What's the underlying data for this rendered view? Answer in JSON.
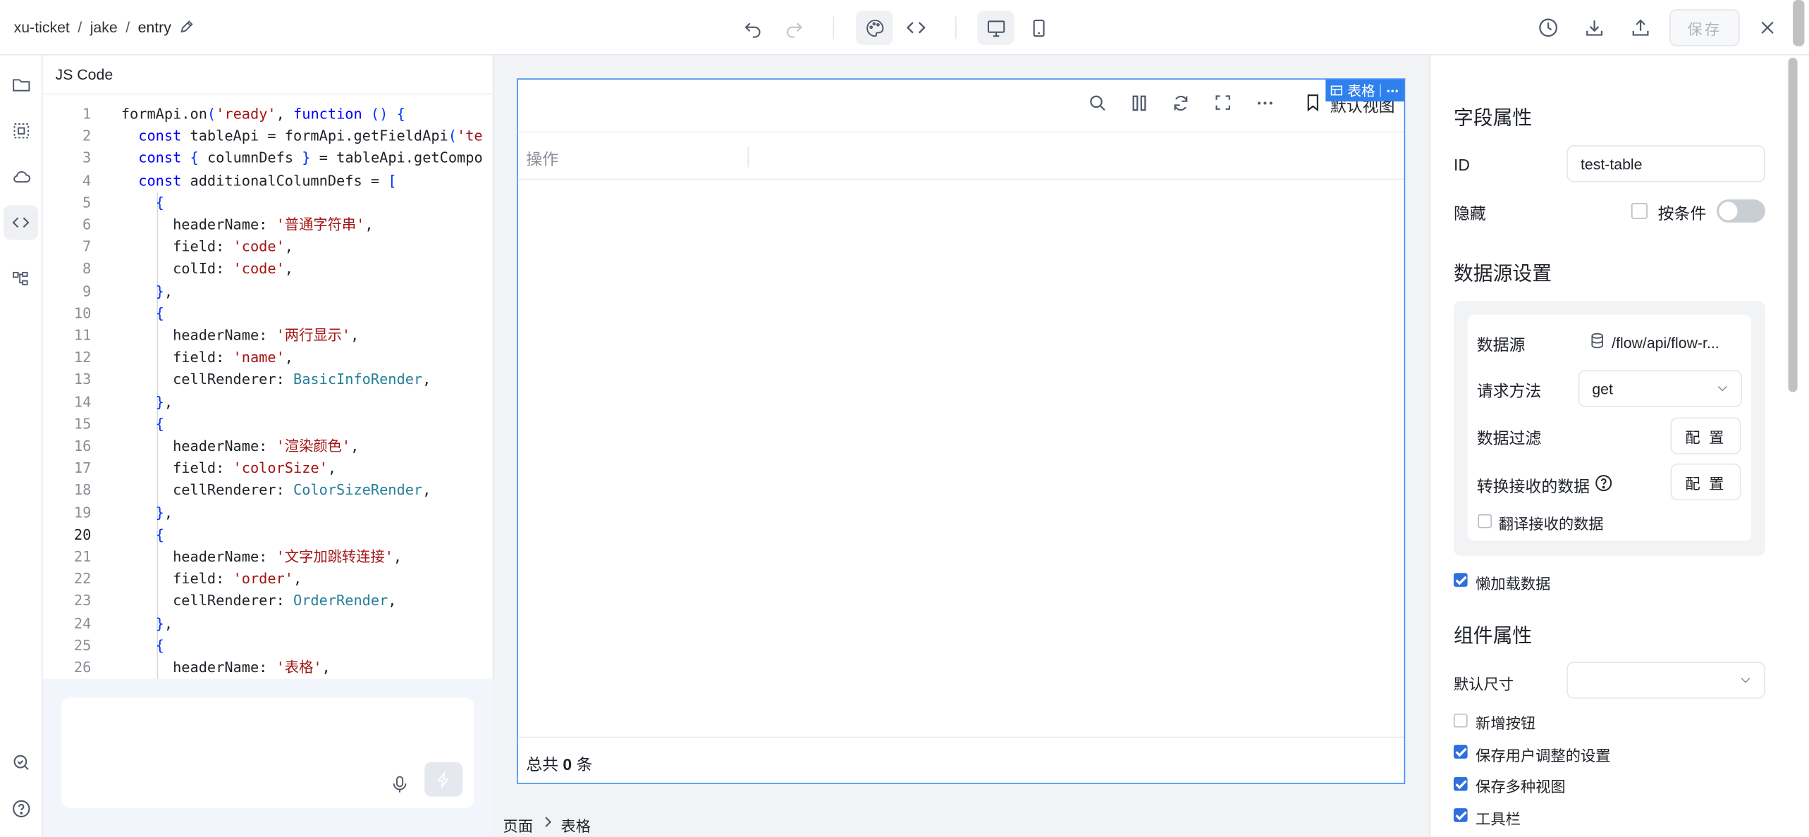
{
  "breadcrumb": {
    "project": "xu-ticket",
    "user": "jake",
    "page": "entry",
    "sep": "/"
  },
  "toolbar": {
    "save_label": "保存"
  },
  "code_panel": {
    "title": "JS Code",
    "current_line": 20,
    "lines": [
      {
        "n": "1"
      },
      {
        "n": "2"
      },
      {
        "n": "3"
      },
      {
        "n": "4"
      },
      {
        "n": "5"
      },
      {
        "n": "6"
      },
      {
        "n": "7"
      },
      {
        "n": "8"
      },
      {
        "n": "9"
      },
      {
        "n": "10"
      },
      {
        "n": "11"
      },
      {
        "n": "12"
      },
      {
        "n": "13"
      },
      {
        "n": "14"
      },
      {
        "n": "15"
      },
      {
        "n": "16"
      },
      {
        "n": "17"
      },
      {
        "n": "18"
      },
      {
        "n": "19"
      },
      {
        "n": "20"
      },
      {
        "n": "21"
      },
      {
        "n": "22"
      },
      {
        "n": "23"
      },
      {
        "n": "24"
      },
      {
        "n": "25"
      },
      {
        "n": "26"
      }
    ],
    "code": [
      "formApi.on('ready', function () {",
      "  const tableApi = formApi.getFieldApi('te",
      "  const { columnDefs } = tableApi.getCompo",
      "  const additionalColumnDefs = [",
      "    {",
      "      headerName: '普通字符串',",
      "      field: 'code',",
      "      colId: 'code',",
      "    },",
      "    {",
      "      headerName: '两行显示',",
      "      field: 'name',",
      "      cellRenderer: BasicInfoRender,",
      "    },",
      "    {",
      "      headerName: '渲染颜色',",
      "      field: 'colorSize',",
      "      cellRenderer: ColorSizeRender,",
      "    },",
      "    {",
      "      headerName: '文字加跳转连接',",
      "      field: 'order',",
      "      cellRenderer: OrderRender,",
      "    },",
      "    {",
      "      headerName: '表格',"
    ]
  },
  "canvas": {
    "tag_label": "表格",
    "view_label": "默认视图",
    "column_header": "操作",
    "footer_prefix": "总共",
    "footer_count": "0",
    "footer_suffix": "条",
    "crumb_page": "页面",
    "crumb_item": "表格"
  },
  "props": {
    "field_section": "字段属性",
    "id_label": "ID",
    "id_value": "test-table",
    "hidden_label": "隐藏",
    "by_condition_label": "按条件",
    "datasource_section": "数据源设置",
    "datasource_label": "数据源",
    "datasource_value": "/flow/api/flow-r...",
    "method_label": "请求方法",
    "method_value": "get",
    "filter_label": "数据过滤",
    "config_label": "配 置",
    "transform_label": "转换接收的数据",
    "translate_label": "翻译接收的数据",
    "lazy_label": "懒加载数据",
    "component_section": "组件属性",
    "default_size_label": "默认尺寸",
    "default_size_value": "",
    "add_button_label": "新增按钮",
    "save_user_label": "保存用户调整的设置",
    "save_views_label": "保存多种视图",
    "toolbar_label": "工具栏"
  },
  "colors": {
    "accent": "#2f80ed",
    "keyword": "#0000ff",
    "string": "#a31515",
    "type": "#267f99"
  }
}
